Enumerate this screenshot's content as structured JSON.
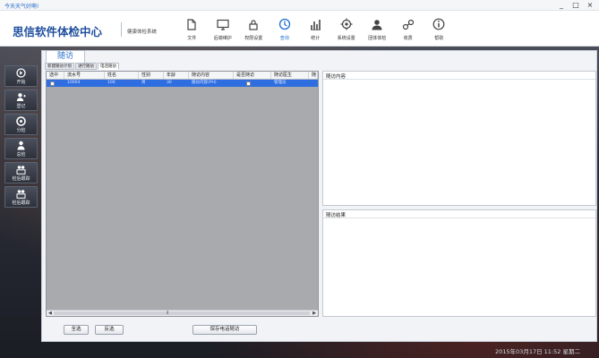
{
  "window": {
    "title": "今天天气好啊!",
    "controls": [
      "_",
      "□",
      "×"
    ]
  },
  "header": {
    "app_title": "思信软件体检中心",
    "sub_title": "健康体检系统",
    "toolbar": [
      {
        "label": "文件",
        "icon": "file-icon"
      },
      {
        "label": "后端维护",
        "icon": "monitor-icon"
      },
      {
        "label": "权限设置",
        "icon": "lock-icon"
      },
      {
        "label": "查询",
        "icon": "search-icon",
        "active": true
      },
      {
        "label": "统计",
        "icon": "bar-chart-icon"
      },
      {
        "label": "系统设置",
        "icon": "gear-icon"
      },
      {
        "label": "团体体检",
        "icon": "group-icon"
      },
      {
        "label": "收费",
        "icon": "yen-icon"
      },
      {
        "label": "帮助",
        "icon": "help-icon"
      }
    ]
  },
  "sidebar": {
    "items": [
      {
        "label": "开始",
        "icon": "start-icon"
      },
      {
        "label": "登记",
        "icon": "register-icon"
      },
      {
        "label": "分检",
        "icon": "check-icon"
      },
      {
        "label": "总检",
        "icon": "doctor-icon"
      },
      {
        "label": "检后跟踪",
        "icon": "follow-icon"
      },
      {
        "label": "检后跟踪",
        "icon": "follow-icon"
      }
    ]
  },
  "main": {
    "page_tab": "随访",
    "sub_tabs": [
      "新建随访计划",
      "进行随访",
      "电话随访"
    ],
    "active_sub_tab": 2,
    "grid": {
      "columns": [
        "选中",
        "流水号",
        "姓名",
        "性别",
        "年龄",
        "随访内容",
        "是否随访",
        "随访医生",
        "随"
      ],
      "rows": [
        [
          "",
          "10004",
          "100",
          "男",
          "30",
          "随访内容(PH)",
          "",
          "管理员",
          ""
        ]
      ]
    },
    "content_panel_title": "随访内容",
    "result_panel_title": "随访结果",
    "buttons": {
      "select_all": "全选",
      "invert": "反选",
      "save": "保存电话随访"
    }
  },
  "status": {
    "clock": "2015年03月17日 11:52 星期二"
  }
}
